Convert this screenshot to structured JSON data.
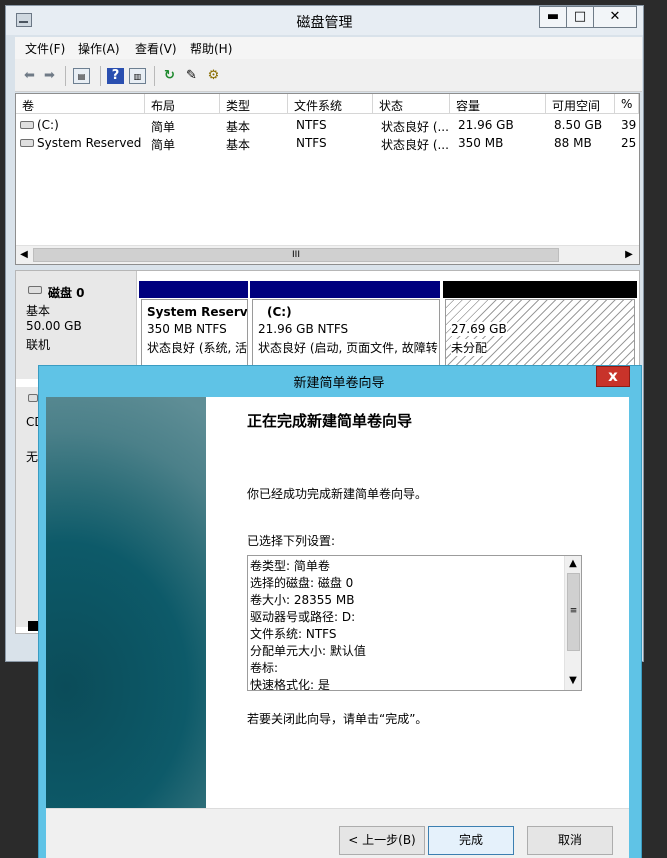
{
  "window": {
    "title": "磁盘管理"
  },
  "menu": [
    "文件(F)",
    "操作(A)",
    "查看(V)",
    "帮助(H)"
  ],
  "toolbar": {
    "icons": [
      "back-arrow-icon",
      "forward-arrow-icon",
      "list-view-icon",
      "help-icon",
      "detail-view-icon",
      "refresh-icon",
      "properties-icon",
      "settings-icon"
    ]
  },
  "volumes": {
    "headers": [
      "卷",
      "布局",
      "类型",
      "文件系统",
      "状态",
      "容量",
      "可用空间",
      "%"
    ],
    "rows": [
      {
        "volume": "(C:)",
        "layout": "简单",
        "type": "基本",
        "fs": "NTFS",
        "status": "状态良好 (...",
        "capacity": "21.96 GB",
        "free": "8.50 GB",
        "pct": "39"
      },
      {
        "volume": "System Reserved",
        "layout": "简单",
        "type": "基本",
        "fs": "NTFS",
        "status": "状态良好 (...",
        "capacity": "350 MB",
        "free": "88 MB",
        "pct": "25"
      }
    ],
    "scroll_thumb": "III"
  },
  "disk0": {
    "name": "磁盘 0",
    "type": "基本",
    "size": "50.00 GB",
    "state": "联机",
    "partitions": [
      {
        "name": "System Reserve",
        "size": "350 MB NTFS",
        "status": "状态良好 (系统, 活"
      },
      {
        "name": "(C:)",
        "size": "21.96 GB NTFS",
        "status": "状态良好 (启动, 页面文件, 故障转"
      },
      {
        "size": "27.69 GB",
        "status": "未分配"
      }
    ]
  },
  "cd": {
    "label": "CD",
    "state": "无"
  },
  "wizard": {
    "title": "新建简单卷向导",
    "close": "x",
    "heading": "正在完成新建简单卷向导",
    "desc": "你已经成功完成新建简单卷向导。",
    "settings_label": "已选择下列设置:",
    "settings": [
      "卷类型: 简单卷",
      "选择的磁盘: 磁盘 0",
      "卷大小: 28355 MB",
      "驱动器号或路径: D:",
      "文件系统: NTFS",
      "分配单元大小: 默认值",
      "卷标:",
      "快速格式化: 是"
    ],
    "finish_note": "若要关闭此向导，请单击“完成”。",
    "buttons": {
      "back": "< 上一步(B)",
      "finish": "完成",
      "cancel": "取消"
    }
  },
  "colors": {
    "primary_band": "#00007e",
    "unallocated_band": "#000000",
    "wizard_frame": "#5fc3e6",
    "close_red": "#c8332a"
  }
}
